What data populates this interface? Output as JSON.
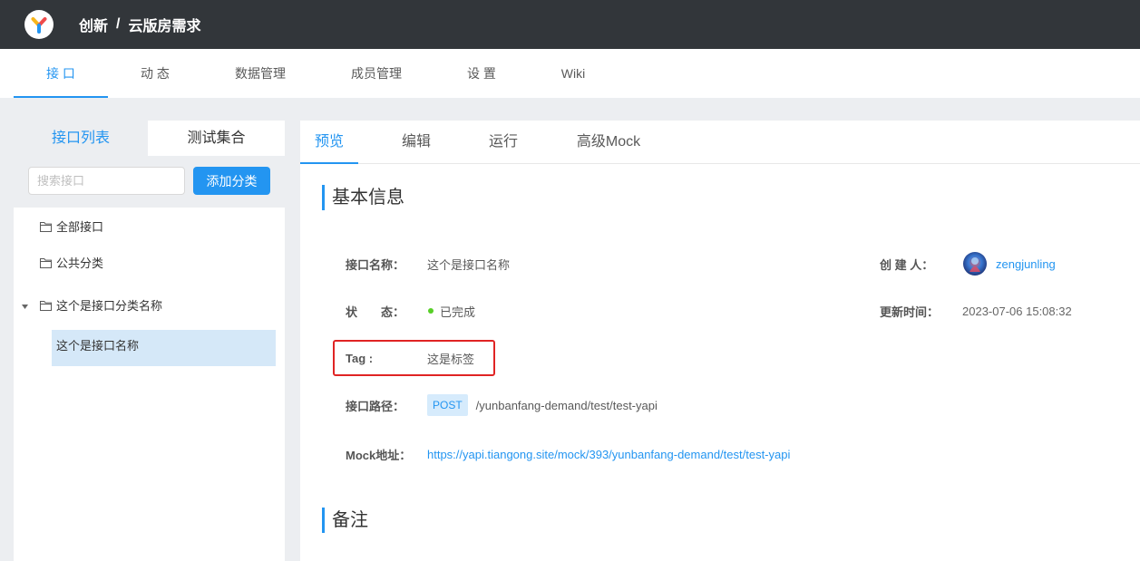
{
  "colors": {
    "accent": "#2395f1",
    "header_bg": "#32363a",
    "page_bg": "#eceef1",
    "selected_bg": "#d5e8f8",
    "status_done": "#57cf27",
    "highlight": "#e02424",
    "method_bg": "#d6ebfc"
  },
  "header": {
    "logo_icon": "yapi-logo-icon",
    "group": "创新",
    "separator": "/",
    "project": "云版房需求"
  },
  "nav": {
    "tabs": [
      {
        "label": "接 口",
        "active": true
      },
      {
        "label": "动 态",
        "active": false
      },
      {
        "label": "数据管理",
        "active": false
      },
      {
        "label": "成员管理",
        "active": false
      },
      {
        "label": "设 置",
        "active": false
      },
      {
        "label": "Wiki",
        "active": false
      }
    ]
  },
  "sidebar": {
    "tabs": [
      {
        "label": "接口列表",
        "active": true
      },
      {
        "label": "测试集合",
        "active": false
      }
    ],
    "search": {
      "placeholder": "搜索接口",
      "value": ""
    },
    "add_category_label": "添加分类",
    "tree": [
      {
        "label": "全部接口",
        "icon": "folder-icon"
      },
      {
        "label": "公共分类",
        "icon": "folder-icon"
      },
      {
        "label": "这个是接口分类名称",
        "icon": "folder-icon",
        "toggle_icon": "caret-down-icon",
        "expanded": true,
        "children": [
          {
            "label": "这个是接口名称",
            "selected": true
          }
        ]
      }
    ]
  },
  "main": {
    "tabs": [
      {
        "label": "预览",
        "active": true
      },
      {
        "label": "编辑",
        "active": false
      },
      {
        "label": "运行",
        "active": false
      },
      {
        "label": "高级Mock",
        "active": false
      }
    ],
    "basic_info": {
      "title": "基本信息",
      "name": {
        "label": "接口名称：",
        "value": "这个是接口名称"
      },
      "creator": {
        "label": "创 建 人：",
        "value": "zengjunling",
        "avatar_icon": "user-avatar-icon"
      },
      "status": {
        "label": "状　　态：",
        "value": "已完成",
        "indicator_icon": "status-dot-icon"
      },
      "updated": {
        "label": "更新时间：",
        "value": "2023-07-06 15:08:32"
      },
      "tag": {
        "label": "Tag :",
        "value": "这是标签"
      },
      "path": {
        "label": "接口路径：",
        "method": "POST",
        "value": "/yunbanfang-demand/test/test-yapi"
      },
      "mock": {
        "label": "Mock地址：",
        "value": "https://yapi.tiangong.site/mock/393/yunbanfang-demand/test/test-yapi"
      }
    },
    "remarks": {
      "title": "备注"
    }
  }
}
